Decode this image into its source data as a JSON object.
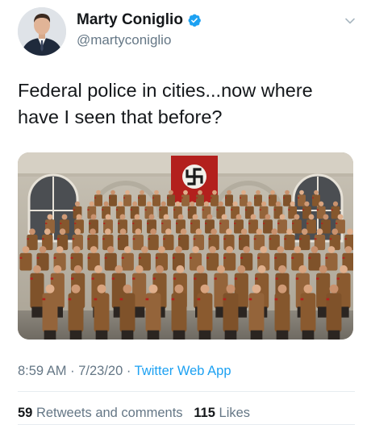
{
  "author": {
    "display_name": "Marty Coniglio",
    "handle": "@martyconiglio",
    "verified": true
  },
  "tweet": {
    "text": "Federal police in cities...now where have I seen that before?"
  },
  "meta": {
    "time": "8:59 AM",
    "sep1": " · ",
    "date": "7/23/20",
    "sep2": " · ",
    "source": "Twitter Web App"
  },
  "stats": {
    "retweets_count": "59",
    "retweets_label": "Retweets and comments",
    "likes_count": "115",
    "likes_label": "Likes"
  },
  "colors": {
    "accent": "#1da1f2",
    "secondary_text": "#657786",
    "divider": "#e6ecf0",
    "flag_red": "#b3201d"
  },
  "icons": {
    "verified": "verified-badge-icon",
    "more": "chevron-down-icon"
  }
}
